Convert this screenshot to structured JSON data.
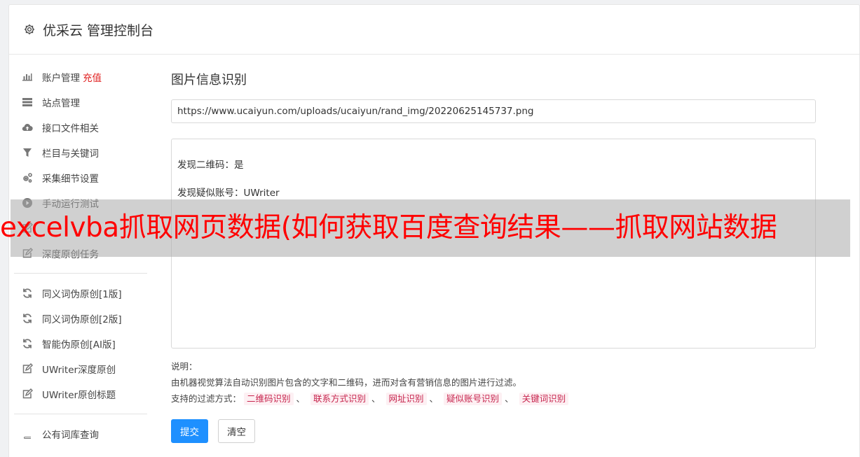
{
  "header": {
    "title": "优采云 管理控制台",
    "icon": "gear-icon"
  },
  "sidebar": {
    "group1": [
      {
        "label": "账户管理",
        "accent": "充值",
        "icon": "bar-chart-icon"
      },
      {
        "label": "站点管理",
        "icon": "server-icon"
      },
      {
        "label": "接口文件相关",
        "icon": "cloud-upload-icon"
      },
      {
        "label": "栏目与关键词",
        "icon": "filter-icon"
      },
      {
        "label": "采集细节设置",
        "icon": "cogs-icon"
      },
      {
        "label": "手动运行测试",
        "icon": "play-circle-icon"
      },
      {
        "label": "",
        "icon": "edit-icon"
      },
      {
        "label": "深度原创任务",
        "icon": "edit-icon"
      }
    ],
    "group2": [
      {
        "label": "同义词伪原创[1版]",
        "icon": "refresh-icon"
      },
      {
        "label": "同义词伪原创[2版]",
        "icon": "refresh-icon"
      },
      {
        "label": "智能伪原创[AI版]",
        "icon": "refresh-icon"
      },
      {
        "label": "UWriter深度原创",
        "icon": "edit-icon"
      },
      {
        "label": "UWriter原创标题",
        "icon": "edit-icon"
      }
    ],
    "group3": [
      {
        "label": "公有词库查询",
        "icon": "book-icon"
      }
    ]
  },
  "main": {
    "title": "图片信息识别",
    "url_value": "https://www.ucaiyun.com/uploads/ucaiyun/rand_img/20220625145737.png",
    "result_lines": [
      "发现二维码：是",
      "发现疑似账号：UWriter"
    ],
    "desc_label": "说明：",
    "desc_text": "由机器视觉算法自动识别图片包含的文字和二维码，进而对含有营销信息的图片进行过滤。",
    "filter_label": "支持的过滤方式：",
    "filters": [
      "二维码识别",
      "联系方式识别",
      "网址识别",
      "疑似账号识别",
      "关键词识别"
    ],
    "filter_sep": "、",
    "submit_label": "提交",
    "clear_label": "清空"
  },
  "overlay": {
    "text": "excelvba抓取网页数据(如何获取百度查询结果——抓取网站数据"
  },
  "colors": {
    "primary": "#1e90ff",
    "accent": "#e02020",
    "tag_text": "#c7254e",
    "tag_bg": "#fdf0f3",
    "overlay_text": "#ff0000"
  }
}
